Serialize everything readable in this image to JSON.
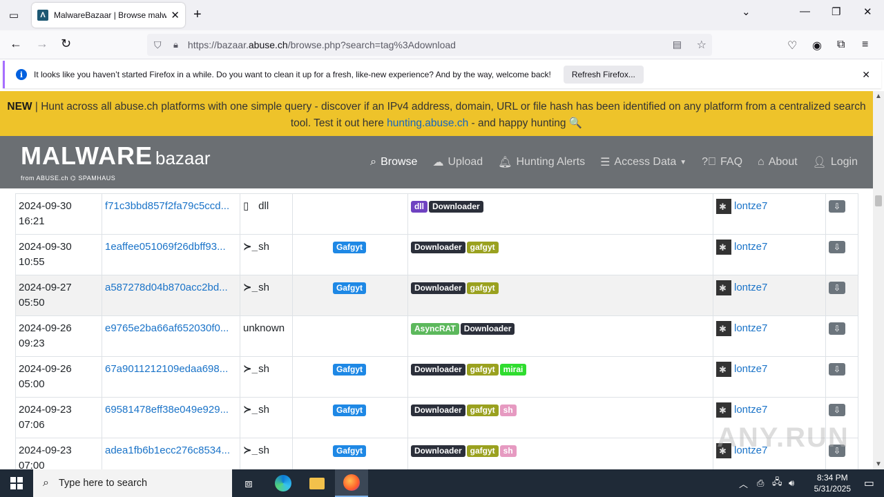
{
  "browser": {
    "tab_title": "MalwareBazaar | Browse malwa",
    "url_prefix": "https://bazaar.",
    "url_domain": "abuse.ch",
    "url_suffix": "/browse.php?search=tag%3Adownload"
  },
  "notification": {
    "message": "It looks like you haven’t started Firefox in a while. Do you want to clean it up for a fresh, like-new experience? And by the way, welcome back!",
    "button": "Refresh Firefox..."
  },
  "banner": {
    "new": "NEW",
    "text": " | Hunt across all abuse.ch platforms with one simple query - discover if an IPv4 address, domain, URL or file hash has been identified on any platform from a centralized search tool. Test it out here ",
    "link": "hunting.abuse.ch",
    "tail": " - and happy hunting 🔍"
  },
  "site": {
    "logo_big": "MALWARE",
    "logo_small": "bazaar",
    "logo_sub": "from ABUSE.ch  ⌬ SPAMHAUS",
    "menu": [
      {
        "label": "Browse",
        "icon": "search-icon"
      },
      {
        "label": "Upload",
        "icon": "cloud-upload-icon"
      },
      {
        "label": "Hunting Alerts",
        "icon": "bell-icon"
      },
      {
        "label": "Access Data",
        "icon": "database-icon"
      },
      {
        "label": "FAQ",
        "icon": "question-icon"
      },
      {
        "label": "About",
        "icon": "building-icon"
      },
      {
        "label": "Login",
        "icon": "user-icon"
      }
    ]
  },
  "rows": [
    {
      "date": "2024-09-30",
      "time": "16:21",
      "hash": "f71c3bbd857f2fa79c5ccd...",
      "type": "dll",
      "type_icon": "file-icon",
      "signature": "",
      "tags": [
        "dll",
        "Downloader"
      ],
      "reporter": "lontze7"
    },
    {
      "date": "2024-09-30",
      "time": "10:55",
      "hash": "1eaffee051069f26dbff93...",
      "type": "sh",
      "type_icon": "terminal-icon",
      "signature": "Gafgyt",
      "tags": [
        "Downloader",
        "gafgyt"
      ],
      "reporter": "lontze7"
    },
    {
      "date": "2024-09-27",
      "time": "05:50",
      "hash": "a587278d04b870acc2bd...",
      "type": "sh",
      "type_icon": "terminal-icon",
      "signature": "Gafgyt",
      "tags": [
        "Downloader",
        "gafgyt"
      ],
      "reporter": "lontze7"
    },
    {
      "date": "2024-09-26",
      "time": "09:23",
      "hash": "e9765e2ba66af652030f0...",
      "type": "unknown",
      "type_icon": "",
      "signature": "",
      "tags": [
        "AsyncRAT",
        "Downloader"
      ],
      "reporter": "lontze7"
    },
    {
      "date": "2024-09-26",
      "time": "05:00",
      "hash": "67a9011212109edaa698...",
      "type": "sh",
      "type_icon": "terminal-icon",
      "signature": "Gafgyt",
      "tags": [
        "Downloader",
        "gafgyt",
        "mirai"
      ],
      "reporter": "lontze7"
    },
    {
      "date": "2024-09-23",
      "time": "07:06",
      "hash": "69581478eff38e049e929...",
      "type": "sh",
      "type_icon": "terminal-icon",
      "signature": "Gafgyt",
      "tags": [
        "Downloader",
        "gafgyt",
        "sh"
      ],
      "reporter": "lontze7"
    },
    {
      "date": "2024-09-23",
      "time": "07:00",
      "hash": "adea1fb6b1ecc276c8534...",
      "type": "sh",
      "type_icon": "terminal-icon",
      "signature": "Gafgyt",
      "tags": [
        "Downloader",
        "gafgyt",
        "sh"
      ],
      "reporter": "lontze7"
    }
  ],
  "taskbar": {
    "search_placeholder": "Type here to search",
    "time": "8:34 PM",
    "date": "5/31/2025"
  },
  "watermark": "ANY.RUN",
  "colors": {
    "banner": "#eec32a",
    "header": "#6b6f73",
    "link": "#1a73c8"
  }
}
